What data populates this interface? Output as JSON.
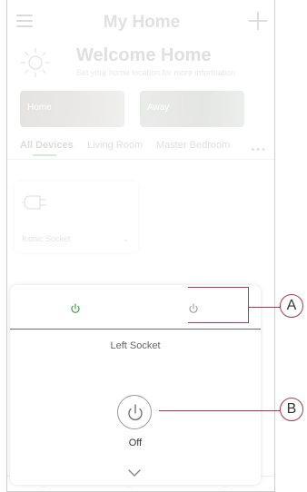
{
  "header": {
    "title": "My Home"
  },
  "welcome": {
    "title": "Welcome Home",
    "subtitle": "Set your home location for more information"
  },
  "modes": [
    {
      "label": "Home"
    },
    {
      "label": "Away"
    }
  ],
  "tabs": [
    {
      "label": "All Devices"
    },
    {
      "label": "Living Room"
    },
    {
      "label": "Master Bedroom"
    }
  ],
  "device": {
    "name": "Iconic Socket"
  },
  "sheet": {
    "socket_label": "Left Socket",
    "power_state": "Off"
  },
  "callouts": {
    "a": "A",
    "b": "B"
  },
  "colors": {
    "accent_green": "#2e9a3f",
    "callout": "#a33a54"
  }
}
